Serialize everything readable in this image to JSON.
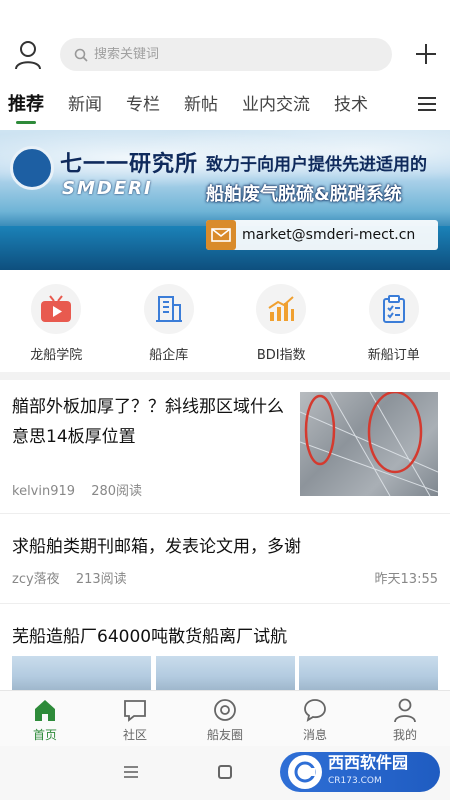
{
  "search": {
    "placeholder": "搜索关键词"
  },
  "tabs": [
    {
      "label": "推荐",
      "active": true
    },
    {
      "label": "新闻"
    },
    {
      "label": "专栏"
    },
    {
      "label": "新帖"
    },
    {
      "label": "业内交流"
    },
    {
      "label": "技术"
    }
  ],
  "banner": {
    "org_cn": "七一一研究所",
    "org_en": "SMDERI",
    "tagline_line1": "致力于向用户提供先进适用的",
    "tagline_line2": "船舶废气脱硫&脱硝系统",
    "email": "market@smderi-mect.cn"
  },
  "quick_links": [
    {
      "label": "龙船学院",
      "icon": "tv-icon",
      "color": "#e85a4f"
    },
    {
      "label": "船企库",
      "icon": "building-icon",
      "color": "#3b7dd8"
    },
    {
      "label": "BDI指数",
      "icon": "bar-chart-icon",
      "color": "#f0a030"
    },
    {
      "label": "新船订单",
      "icon": "clipboard-icon",
      "color": "#3b7dd8"
    }
  ],
  "articles": [
    {
      "title": "艏部外板加厚了？？斜线那区域什么意思14板厚位置",
      "author": "kelvin919",
      "reads": "280阅读"
    },
    {
      "title": "求船舶类期刊邮箱，发表论文用，多谢",
      "author": "zcy落夜",
      "reads": "213阅读",
      "time": "昨天13:55"
    },
    {
      "title": "芜船造船厂64000吨散货船离厂试航"
    }
  ],
  "bottom_nav": [
    {
      "label": "首页",
      "icon": "home-icon",
      "active": true
    },
    {
      "label": "社区",
      "icon": "community-icon"
    },
    {
      "label": "船友圈",
      "icon": "circle-icon"
    },
    {
      "label": "消息",
      "icon": "message-icon"
    },
    {
      "label": "我的",
      "icon": "profile-icon"
    }
  ],
  "watermark": {
    "text": "西西软件园",
    "sub": "CR173.COM"
  },
  "colors": {
    "accent": "#2e8b3a"
  }
}
